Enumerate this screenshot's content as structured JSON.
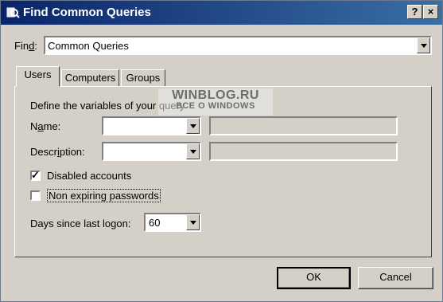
{
  "window": {
    "title": "Find Common Queries",
    "help_glyph": "?",
    "close_glyph": "×"
  },
  "find": {
    "label_accel": "d",
    "label_text": "Fin",
    "label_colon": ":",
    "value": "Common Queries"
  },
  "tabs": [
    {
      "label": "Users",
      "active": true
    },
    {
      "label": "Computers",
      "active": false
    },
    {
      "label": "Groups",
      "active": false
    }
  ],
  "users_tab": {
    "define_label": "Define the variables of your query",
    "name": {
      "label_accel": "a",
      "label_pre": "N",
      "label_post": "me:",
      "value": "",
      "text": ""
    },
    "description": {
      "label_pre": "Descr",
      "label_accel": "i",
      "label_post": "ption:",
      "value": "",
      "text": ""
    },
    "disabled_accounts": {
      "label": "Disabled accounts",
      "checked": true,
      "check_glyph": "✓"
    },
    "non_expiring": {
      "label": "Non expiring passwords",
      "checked": false
    },
    "days_since_logon": {
      "label": "Days since last logon:",
      "value": "60"
    }
  },
  "buttons": {
    "ok_label": "OK",
    "cancel_label": "Cancel"
  },
  "watermark": {
    "line1": "WINBLOG.RU",
    "line2": "ВСЕ О WINDOWS"
  },
  "colors": {
    "title_start": "#0a246a",
    "title_end": "#3a6ea5",
    "face": "#d4d0c8"
  },
  "icons": {
    "title": "find-queries-icon",
    "dropdown": "chevron-down-icon",
    "checkmark": "checkmark-icon"
  }
}
